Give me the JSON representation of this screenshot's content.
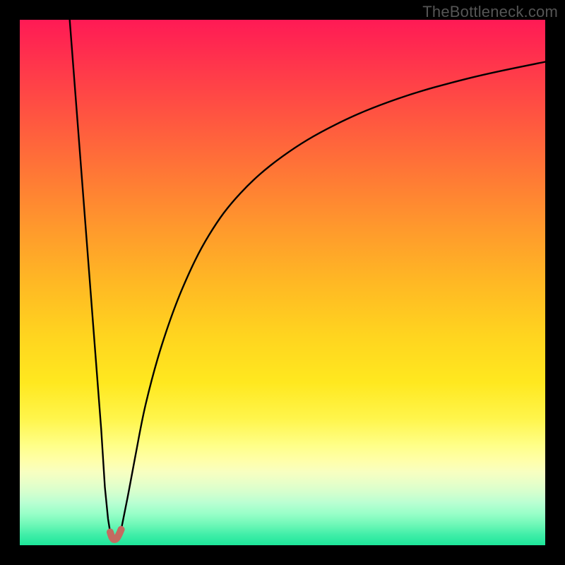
{
  "watermark": "TheBottleneck.com",
  "chart_data": {
    "type": "line",
    "title": "",
    "xlabel": "",
    "ylabel": "",
    "xlim": [
      0,
      100
    ],
    "ylim": [
      0,
      100
    ],
    "series": [
      {
        "name": "left-branch",
        "x": [
          9.5,
          10.5,
          11.5,
          12.5,
          13.5,
          14.5,
          15.5,
          16.2,
          16.8,
          17.2
        ],
        "values": [
          100,
          87,
          74,
          61,
          48,
          35,
          22,
          11,
          5,
          2.5
        ]
      },
      {
        "name": "dip",
        "x": [
          17.2,
          17.6,
          18.0,
          18.4,
          18.8,
          19.3
        ],
        "values": [
          2.5,
          1.3,
          1.1,
          1.3,
          2.0,
          3.0
        ]
      },
      {
        "name": "right-branch",
        "x": [
          19.3,
          20.5,
          22,
          24,
          27,
          31,
          36,
          42,
          50,
          60,
          72,
          86,
          100
        ],
        "values": [
          3.0,
          9,
          17,
          27,
          38,
          49,
          59,
          67,
          74,
          80,
          85,
          89,
          92
        ]
      }
    ],
    "dip_marker": {
      "color": "#c46a60",
      "points_x": [
        17.2,
        17.5,
        17.8,
        18.1,
        18.4,
        18.7,
        19.0,
        19.3
      ],
      "points_y": [
        2.5,
        1.6,
        1.15,
        1.1,
        1.25,
        1.7,
        2.3,
        3.0
      ]
    },
    "colors": {
      "curve": "#000000",
      "background_frame": "#000000"
    }
  }
}
